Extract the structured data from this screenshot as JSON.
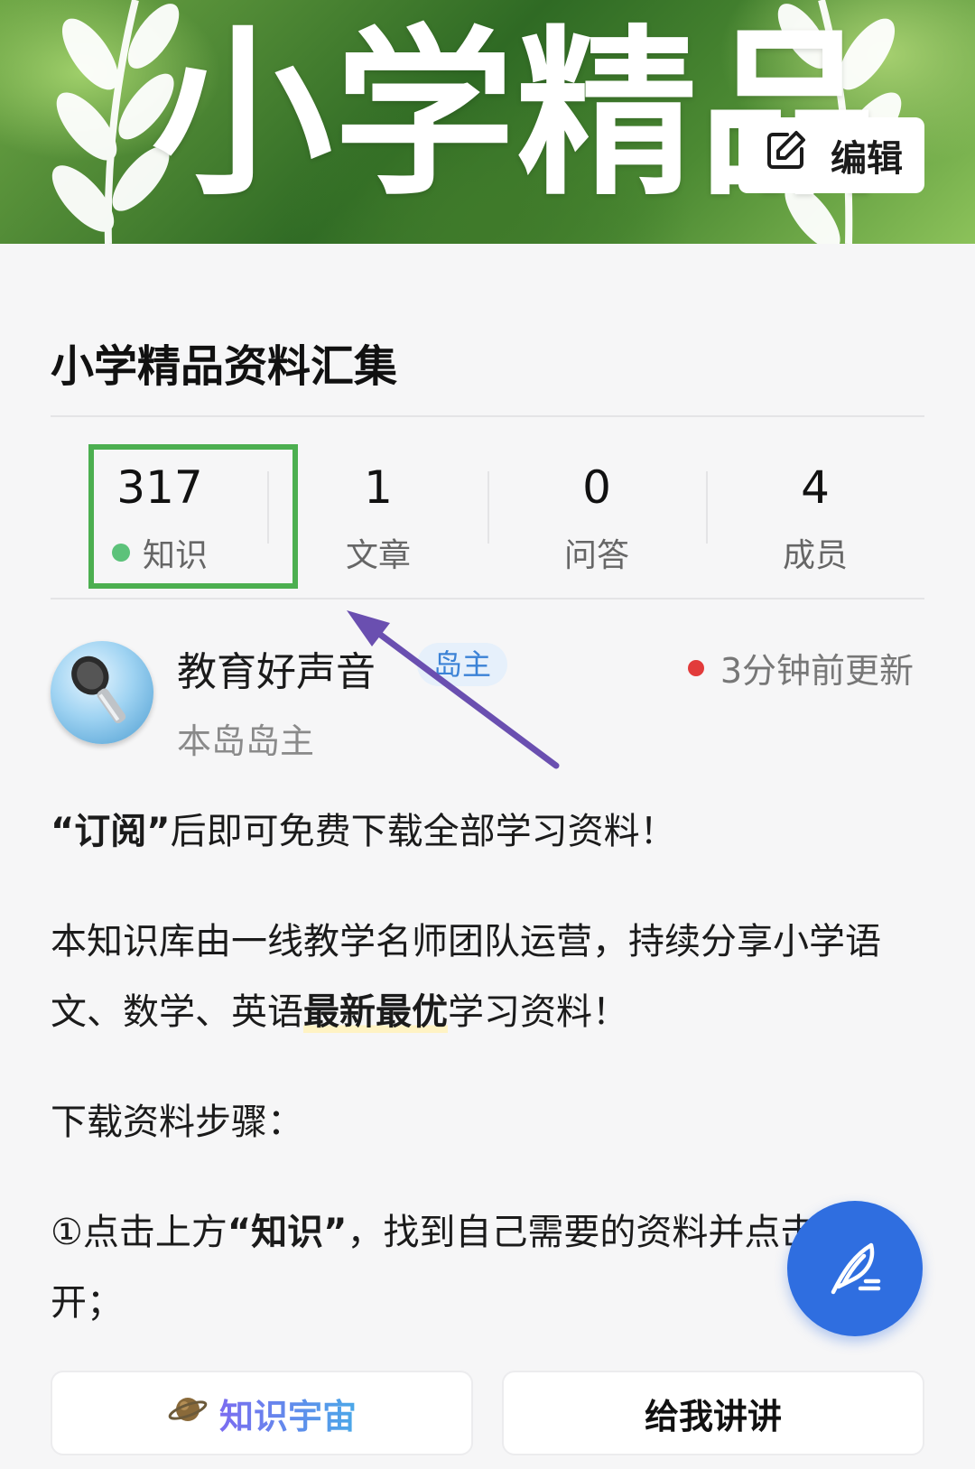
{
  "banner": {
    "title": "小学精品",
    "edit_label": "编辑"
  },
  "group": {
    "title": "小学精品资料汇集"
  },
  "stats": [
    {
      "value": "317",
      "label": "知识"
    },
    {
      "value": "1",
      "label": "文章"
    },
    {
      "value": "0",
      "label": "问答"
    },
    {
      "value": "4",
      "label": "成员"
    }
  ],
  "owner": {
    "name": "教育好声音",
    "badge": "岛主",
    "subtitle": "本岛岛主",
    "updated": "3分钟前更新"
  },
  "content": {
    "p1_quote": "“订阅”",
    "p1_rest": "后即可免费下载全部学习资料！",
    "p2_a": "本知识库由一线教学名师团队运营，持续分享小学语文、数学、英语",
    "p2_bold": "最新最优",
    "p2_c": "学习资料！",
    "p3": "下载资料步骤：",
    "p4_a": "①点击上方",
    "p4_bold": "“知识”",
    "p4_c": "，找到自己需要的资料并点击打开；"
  },
  "buttons": {
    "universe_label": "知识宇宙",
    "explain_label": "给我讲讲"
  },
  "colors": {
    "highlight_box": "#4caf50",
    "fab": "#2f6ee0",
    "badge_bg": "#e6f0fb",
    "badge_text": "#3b82d6",
    "arrow": "#6a4fb0"
  },
  "icons": {
    "edit": "edit-icon",
    "fab": "feather-pen-icon",
    "universe": "planet-icon"
  }
}
